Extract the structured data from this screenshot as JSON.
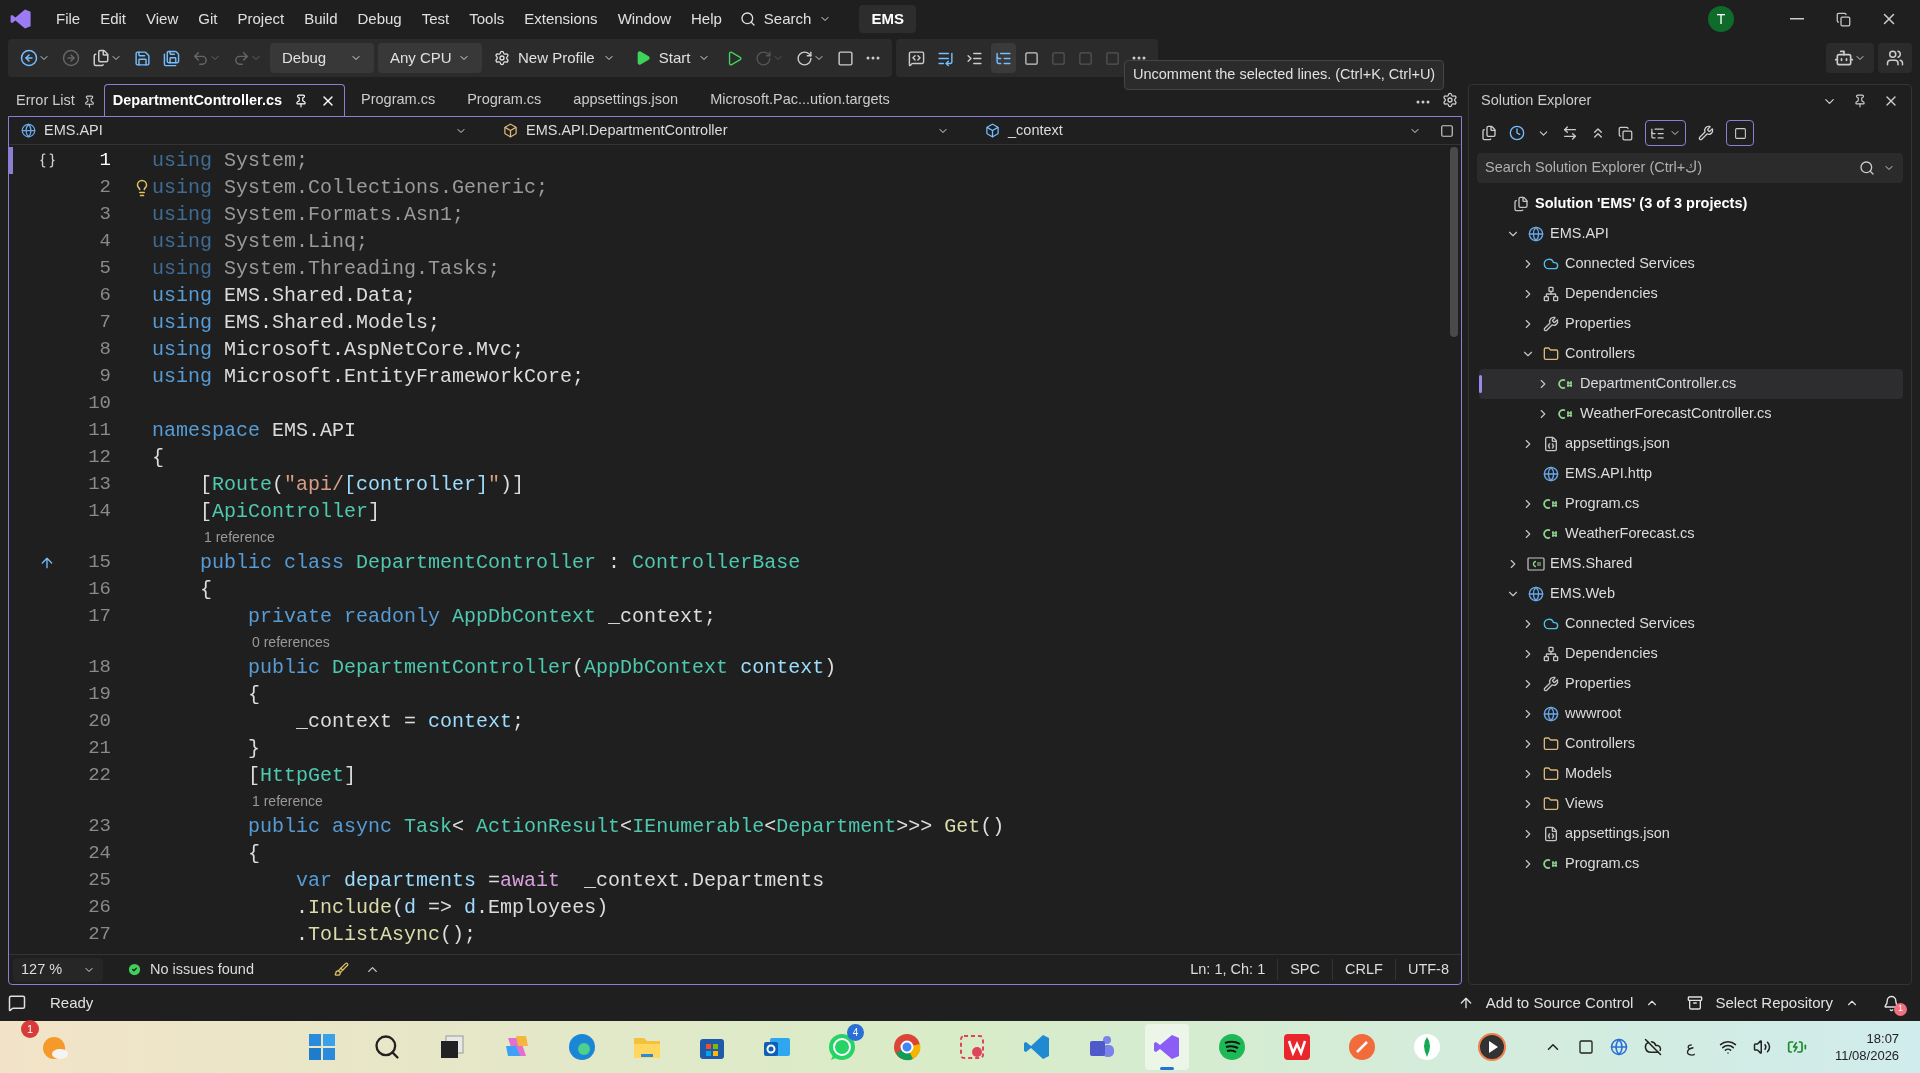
{
  "menu": {
    "items": [
      "File",
      "Edit",
      "View",
      "Git",
      "Project",
      "Build",
      "Debug",
      "Test",
      "Tools",
      "Extensions",
      "Window",
      "Help"
    ],
    "search": "Search",
    "solution_name": "EMS",
    "avatar": "T"
  },
  "toolbar": {
    "configuration": "Debug",
    "platform": "Any CPU",
    "profile": "New Profile",
    "start": "Start"
  },
  "tooltip": "Uncomment the selected lines. (Ctrl+K, Ctrl+U)",
  "tool_tab": "Error List",
  "tabs": [
    {
      "label": "DepartmentController.cs",
      "selected": true
    },
    {
      "label": "Program.cs",
      "selected": false
    },
    {
      "label": "Program.cs",
      "selected": false
    },
    {
      "label": "appsettings.json",
      "selected": false
    },
    {
      "label": "Microsoft.Pac...ution.targets",
      "selected": false
    }
  ],
  "nav": {
    "project": "EMS.API",
    "type": "EMS.API.DepartmentController",
    "member": "_context"
  },
  "code": [
    {
      "kind": "code",
      "number": "1",
      "tokens": [
        {
          "kind": "faded_keyword",
          "text": "using"
        },
        {
          "kind": "faded",
          "text": " System;"
        }
      ]
    },
    {
      "kind": "code",
      "number": "2",
      "tokens": [
        {
          "kind": "faded_keyword",
          "text": "using"
        },
        {
          "kind": "faded",
          "text": " System.Collections.Generic;"
        }
      ]
    },
    {
      "kind": "code",
      "number": "3",
      "tokens": [
        {
          "kind": "faded_keyword",
          "text": "using"
        },
        {
          "kind": "faded",
          "text": " System.Formats.Asn1;"
        }
      ]
    },
    {
      "kind": "code",
      "number": "4",
      "tokens": [
        {
          "kind": "faded_keyword",
          "text": "using"
        },
        {
          "kind": "faded",
          "text": " System.Linq;"
        }
      ]
    },
    {
      "kind": "code",
      "number": "5",
      "tokens": [
        {
          "kind": "faded_keyword",
          "text": "using"
        },
        {
          "kind": "faded",
          "text": " System.Threading.Tasks;"
        }
      ]
    },
    {
      "kind": "code",
      "number": "6",
      "tokens": [
        {
          "kind": "keyword",
          "text": "using"
        },
        {
          "kind": "plain",
          "text": " EMS.Shared.Data;"
        }
      ]
    },
    {
      "kind": "code",
      "number": "7",
      "tokens": [
        {
          "kind": "keyword",
          "text": "using"
        },
        {
          "kind": "plain",
          "text": " EMS.Shared.Models;"
        }
      ]
    },
    {
      "kind": "code",
      "number": "8",
      "tokens": [
        {
          "kind": "keyword",
          "text": "using"
        },
        {
          "kind": "plain",
          "text": " Microsoft.AspNetCore.Mvc;"
        }
      ]
    },
    {
      "kind": "code",
      "number": "9",
      "tokens": [
        {
          "kind": "keyword",
          "text": "using"
        },
        {
          "kind": "plain",
          "text": " Microsoft.EntityFrameworkCore;"
        }
      ]
    },
    {
      "kind": "code",
      "number": "10"
    },
    {
      "kind": "code",
      "number": "11",
      "tokens": [
        {
          "kind": "keyword",
          "text": "namespace"
        },
        {
          "kind": "plain",
          "text": " EMS.API"
        }
      ]
    },
    {
      "kind": "code",
      "number": "12",
      "tokens": [
        {
          "kind": "plain",
          "text": "{"
        }
      ]
    },
    {
      "kind": "code",
      "number": "13",
      "tokens": [
        {
          "kind": "plain",
          "text": "    ["
        },
        {
          "kind": "type",
          "text": "Route"
        },
        {
          "kind": "plain",
          "text": "("
        },
        {
          "kind": "string",
          "text": "\"api/"
        },
        {
          "kind": "param",
          "text": "[controller]"
        },
        {
          "kind": "string",
          "text": "\""
        },
        {
          "kind": "plain",
          "text": ")]"
        }
      ]
    },
    {
      "kind": "code",
      "number": "14",
      "tokens": [
        {
          "kind": "plain",
          "text": "    ["
        },
        {
          "kind": "type",
          "text": "ApiController"
        },
        {
          "kind": "plain",
          "text": "]"
        }
      ]
    },
    {
      "kind": "lens",
      "text": "1 reference"
    },
    {
      "kind": "code",
      "number": "15",
      "tokens": [
        {
          "kind": "keyword",
          "text": "    public class "
        },
        {
          "kind": "type",
          "text": "DepartmentController"
        },
        {
          "kind": "plain",
          "text": " : "
        },
        {
          "kind": "type",
          "text": "ControllerBase"
        }
      ]
    },
    {
      "kind": "code",
      "number": "16",
      "tokens": [
        {
          "kind": "plain",
          "text": "    {"
        }
      ]
    },
    {
      "kind": "code",
      "number": "17",
      "tokens": [
        {
          "kind": "keyword",
          "text": "        private readonly "
        },
        {
          "kind": "type",
          "text": "AppDbContext"
        },
        {
          "kind": "plain",
          "text": " _context;"
        }
      ]
    },
    {
      "kind": "lens",
      "text": "0 references"
    },
    {
      "kind": "code",
      "number": "18",
      "tokens": [
        {
          "kind": "keyword",
          "text": "        public "
        },
        {
          "kind": "type",
          "text": "DepartmentController"
        },
        {
          "kind": "plain",
          "text": "("
        },
        {
          "kind": "type",
          "text": "AppDbContext "
        },
        {
          "kind": "param",
          "text": "context"
        },
        {
          "kind": "plain",
          "text": ")"
        }
      ]
    },
    {
      "kind": "code",
      "number": "19",
      "tokens": [
        {
          "kind": "plain",
          "text": "        {"
        }
      ]
    },
    {
      "kind": "code",
      "number": "20",
      "tokens": [
        {
          "kind": "plain",
          "text": "            _context = "
        },
        {
          "kind": "param",
          "text": "context"
        },
        {
          "kind": "plain",
          "text": ";"
        }
      ]
    },
    {
      "kind": "code",
      "number": "21",
      "tokens": [
        {
          "kind": "plain",
          "text": "        }"
        }
      ]
    },
    {
      "kind": "code",
      "number": "22",
      "tokens": [
        {
          "kind": "plain",
          "text": "        ["
        },
        {
          "kind": "type",
          "text": "HttpGet"
        },
        {
          "kind": "plain",
          "text": "]"
        }
      ]
    },
    {
      "kind": "lens",
      "text": "1 reference"
    },
    {
      "kind": "code",
      "number": "23",
      "tokens": [
        {
          "kind": "keyword",
          "text": "        public async "
        },
        {
          "kind": "type",
          "text": "Task"
        },
        {
          "kind": "plain",
          "text": "< "
        },
        {
          "kind": "type",
          "text": "ActionResult"
        },
        {
          "kind": "plain",
          "text": "<"
        },
        {
          "kind": "type",
          "text": "IEnumerable"
        },
        {
          "kind": "plain",
          "text": "<"
        },
        {
          "kind": "type",
          "text": "Department"
        },
        {
          "kind": "plain",
          "text": ">>> "
        },
        {
          "kind": "method",
          "text": "Get"
        },
        {
          "kind": "plain",
          "text": "()"
        }
      ]
    },
    {
      "kind": "code",
      "number": "24",
      "tokens": [
        {
          "kind": "plain",
          "text": "        {"
        }
      ]
    },
    {
      "kind": "code",
      "number": "25",
      "tokens": [
        {
          "kind": "keyword",
          "text": "            var "
        },
        {
          "kind": "param",
          "text": "departments"
        },
        {
          "kind": "plain",
          "text": " ="
        },
        {
          "kind": "control",
          "text": "await"
        },
        {
          "kind": "plain",
          "text": "  _context.Departments"
        }
      ]
    },
    {
      "kind": "code",
      "number": "26",
      "tokens": [
        {
          "kind": "plain",
          "text": "            ."
        },
        {
          "kind": "method",
          "text": "Include"
        },
        {
          "kind": "plain",
          "text": "("
        },
        {
          "kind": "param",
          "text": "d"
        },
        {
          "kind": "plain",
          "text": " => "
        },
        {
          "kind": "param",
          "text": "d"
        },
        {
          "kind": "plain",
          "text": ".Employees)"
        }
      ]
    },
    {
      "kind": "code",
      "number": "27",
      "tokens": [
        {
          "kind": "plain",
          "text": "            ."
        },
        {
          "kind": "method",
          "text": "ToListAsync"
        },
        {
          "kind": "plain",
          "text": "();"
        }
      ]
    }
  ],
  "editor_status": {
    "zoom": "127 %",
    "issues": "No issues found",
    "position": "Ln: 1, Ch: 1",
    "indent": "SPC",
    "line_endings": "CRLF",
    "encoding": "UTF-8"
  },
  "solution_explorer": {
    "title": "Solution Explorer",
    "search": {
      "placeholder": "Search Solution Explorer (Ctrl+ك)"
    },
    "tree": [
      {
        "label": "Solution 'EMS' (3 of 3 projects)",
        "kind": "solution",
        "selected": false,
        "children": [
          {
            "label": "EMS.API",
            "kind": "webproject",
            "expanded": true,
            "selected": false,
            "children": [
              {
                "label": "Connected Services",
                "kind": "connected",
                "expanded": false,
                "selected": false
              },
              {
                "label": "Dependencies",
                "kind": "deps",
                "expanded": false,
                "selected": false
              },
              {
                "label": "Properties",
                "kind": "props",
                "expanded": false,
                "selected": false
              },
              {
                "label": "Controllers",
                "kind": "folder",
                "expanded": true,
                "selected": false,
                "children": [
                  {
                    "label": "DepartmentController.cs",
                    "kind": "csharp",
                    "expanded": false,
                    "selected": true
                  },
                  {
                    "label": "WeatherForecastController.cs",
                    "kind": "csharp",
                    "expanded": false,
                    "selected": false
                  }
                ]
              },
              {
                "label": "appsettings.json",
                "kind": "json",
                "expanded": false,
                "selected": false
              },
              {
                "label": "EMS.API.http",
                "kind": "http",
                "selected": false
              },
              {
                "label": "Program.cs",
                "kind": "csharp",
                "expanded": false,
                "selected": false
              },
              {
                "label": "WeatherForecast.cs",
                "kind": "csharp",
                "expanded": false,
                "selected": false
              }
            ]
          },
          {
            "label": "EMS.Shared",
            "kind": "libproject",
            "expanded": false,
            "selected": false
          },
          {
            "label": "EMS.Web",
            "kind": "webproject",
            "expanded": true,
            "selected": false,
            "children": [
              {
                "label": "Connected Services",
                "kind": "connected",
                "expanded": false,
                "selected": false
              },
              {
                "label": "Dependencies",
                "kind": "deps",
                "expanded": false,
                "selected": false
              },
              {
                "label": "Properties",
                "kind": "props",
                "expanded": false,
                "selected": false
              },
              {
                "label": "wwwroot",
                "kind": "globe",
                "expanded": false,
                "selected": false
              },
              {
                "label": "Controllers",
                "kind": "folder",
                "expanded": false,
                "selected": false
              },
              {
                "label": "Models",
                "kind": "folder",
                "expanded": false,
                "selected": false
              },
              {
                "label": "Views",
                "kind": "folder",
                "expanded": false,
                "selected": false
              },
              {
                "label": "appsettings.json",
                "kind": "json",
                "expanded": false,
                "selected": false
              },
              {
                "label": "Program.cs",
                "kind": "csharp",
                "expanded": false,
                "selected": false
              }
            ]
          }
        ]
      }
    ]
  },
  "status_bar": {
    "state": "Ready",
    "source_control": "Add to Source Control",
    "repository": "Select Repository",
    "notifications": "1"
  },
  "taskbar": {
    "weather_badge": "1",
    "apps": [
      {
        "kind": "start"
      },
      {
        "kind": "search"
      },
      {
        "kind": "taskview"
      },
      {
        "kind": "copilot"
      },
      {
        "kind": "edge"
      },
      {
        "kind": "explorer"
      },
      {
        "kind": "store"
      },
      {
        "kind": "outlook"
      },
      {
        "kind": "whatsapp",
        "badge": "4"
      },
      {
        "kind": "chrome"
      },
      {
        "kind": "snip"
      },
      {
        "kind": "vscode"
      },
      {
        "kind": "teams"
      },
      {
        "kind": "visualstudio",
        "selected": true
      },
      {
        "kind": "spotify"
      },
      {
        "kind": "wps"
      },
      {
        "kind": "postman"
      },
      {
        "kind": "mongodb"
      },
      {
        "kind": "player"
      }
    ],
    "language": "ع",
    "time": "18:07",
    "date": "11/08/2026"
  }
}
